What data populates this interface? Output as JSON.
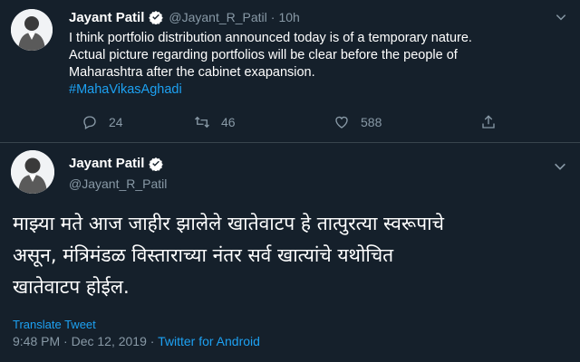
{
  "colors": {
    "background": "#15202b",
    "accent": "#1da1f2",
    "muted": "#8899a6",
    "divider": "#38444d"
  },
  "reply_tweet": {
    "author": {
      "name": "Jayant Patil",
      "handle": "@Jayant_R_Patil",
      "verified": true
    },
    "separator": "·",
    "time": "10h",
    "text_lines": [
      "I think portfolio distribution announced today is of a temporary nature.",
      "Actual picture regarding portfolios will be clear before the people of",
      "Maharashtra after the cabinet exapansion."
    ],
    "hashtag": "#MahaVikasAghadi",
    "stats": {
      "replies": "24",
      "retweets": "46",
      "likes": "588"
    },
    "icons": [
      "reply-icon",
      "retweet-icon",
      "like-icon",
      "share-icon",
      "chevron-down-icon",
      "verified-icon"
    ]
  },
  "main_tweet": {
    "author": {
      "name": "Jayant Patil",
      "handle": "@Jayant_R_Patil",
      "verified": true
    },
    "text_lines": [
      "माझ्या मते आज जाहीर झालेले खातेवाटप हे तात्पुरत्या स्वरूपाचे",
      "असून, मंत्रिमंडळ विस्ताराच्या नंतर सर्व खात्यांचे यथोचित",
      "खातेवाटप होईल."
    ],
    "translate_label": "Translate Tweet",
    "time": "9:48 PM",
    "separator": "·",
    "date": "Dec 12, 2019",
    "source": "Twitter for Android"
  }
}
